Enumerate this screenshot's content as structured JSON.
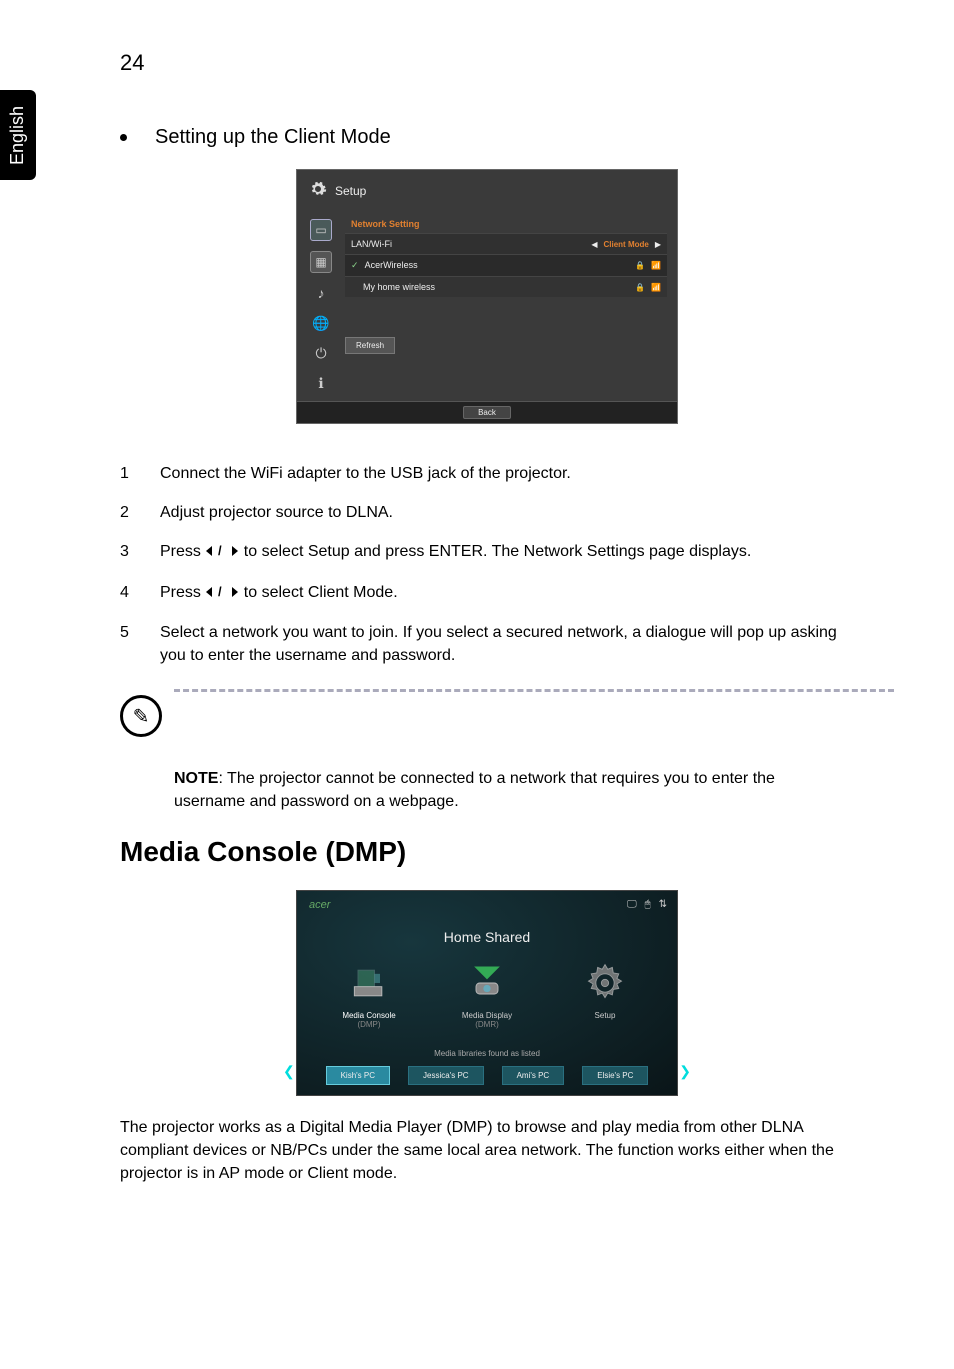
{
  "tab_label": "English",
  "page_number": "24",
  "bullet_heading": "Setting up the Client Mode",
  "setup": {
    "title": "Setup",
    "section_label": "Network Setting",
    "row_header_left": "LAN/Wi-Fi",
    "row_header_value": "Client Mode",
    "networks": [
      {
        "name": "AcerWireless",
        "checked": true
      },
      {
        "name": "My home wireless",
        "checked": false
      }
    ],
    "refresh": "Refresh",
    "back": "Back"
  },
  "steps": [
    {
      "n": "1",
      "t": "Connect the WiFi adapter to the USB jack of the projector."
    },
    {
      "n": "2",
      "t": "Adjust projector source to DLNA."
    },
    {
      "n": "3",
      "t_pre": "Press ",
      "t_post": " to select Setup and press ENTER. The Network Settings page displays."
    },
    {
      "n": "4",
      "t_pre": "Press ",
      "t_post": " to select Client Mode."
    },
    {
      "n": "5",
      "t": "Select a network you want to join. If you select a secured network, a dialogue will pop up asking you to enter the username and password."
    }
  ],
  "note": {
    "label": "NOTE",
    "text": ": The projector cannot be connected to a network that requires you to enter the username and password on a webpage."
  },
  "section_heading": "Media Console (DMP)",
  "home": {
    "brand": "acer",
    "title": "Home Shared",
    "items": [
      {
        "l1": "Media Console",
        "l2": "(DMP)"
      },
      {
        "l1": "Media Display",
        "l2": "(DMR)"
      },
      {
        "l1": "Setup",
        "l2": ""
      }
    ],
    "subtitle": "Media libraries found as listed",
    "pcs": [
      "Kish's PC",
      "Jessica's PC",
      "Ami's PC",
      "Elsie's PC"
    ]
  },
  "bottom_para": "The projector works as a Digital Media Player (DMP) to browse and play media from other DLNA compliant devices or NB/PCs under the same local area network. The function works either when the projector is in AP mode or Client mode."
}
